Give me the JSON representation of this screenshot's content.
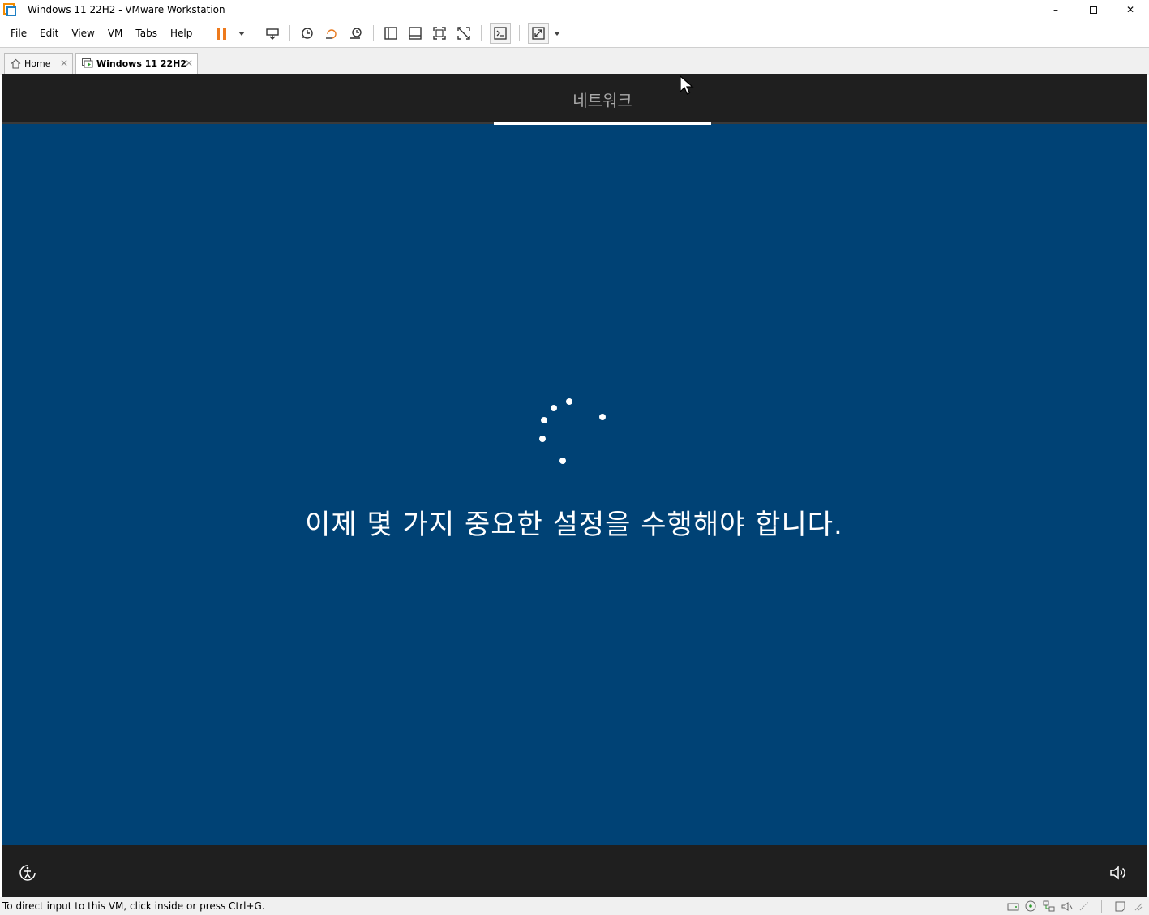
{
  "window": {
    "title": "Windows 11 22H2 - VMware Workstation"
  },
  "window_controls": {
    "minimize": "–",
    "close": "✕"
  },
  "menu": [
    "File",
    "Edit",
    "View",
    "VM",
    "Tabs",
    "Help"
  ],
  "tabs": [
    {
      "label": "Home",
      "close": "✕"
    },
    {
      "label": "Windows 11 22H2",
      "close": "✕"
    }
  ],
  "vm": {
    "step_label": "네트워크",
    "message": "이제 몇 가지 중요한 설정을 수행해야 합니다."
  },
  "statusbar": {
    "text": "To direct input to this VM, click inside or press Ctrl+G."
  },
  "colors": {
    "oobe_background": "#004275",
    "oobe_bars": "#1f1f1f",
    "pause_accent": "#ee7a1c"
  }
}
